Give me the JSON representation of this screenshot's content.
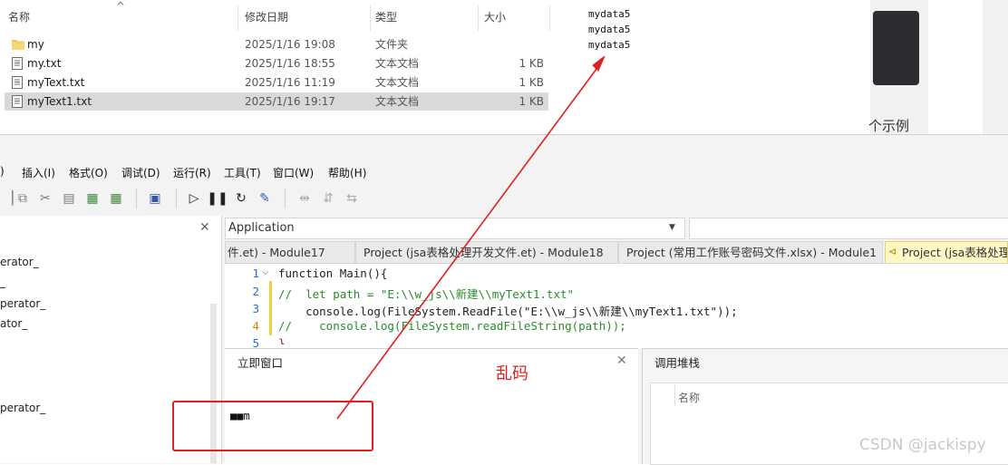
{
  "explorer": {
    "columns": [
      {
        "label": "名称"
      },
      {
        "label": "修改日期"
      },
      {
        "label": "类型"
      },
      {
        "label": "大小"
      }
    ],
    "sort_indicator": "^",
    "files": [
      {
        "name": "my",
        "date": "2025/1/16 19:08",
        "type": "文件夹",
        "size": "",
        "icon": "folder-icon",
        "selected": false
      },
      {
        "name": "my.txt",
        "date": "2025/1/16 18:55",
        "type": "文本文档",
        "size": "1 KB",
        "icon": "text-file-icon",
        "selected": false
      },
      {
        "name": "myText.txt",
        "date": "2025/1/16 11:19",
        "type": "文本文档",
        "size": "1 KB",
        "icon": "text-file-icon",
        "selected": false
      },
      {
        "name": "myText1.txt",
        "date": "2025/1/16 19:17",
        "type": "文本文档",
        "size": "1 KB",
        "icon": "text-file-icon",
        "selected": true
      }
    ]
  },
  "notepad": {
    "lines": [
      "mydata5",
      "mydata5",
      "mydata5"
    ]
  },
  "side_text": "个示例",
  "ide": {
    "menu": [
      {
        "label": ")"
      },
      {
        "label": "插入(I)"
      },
      {
        "label": "格式(O)"
      },
      {
        "label": "调试(D)"
      },
      {
        "label": "运行(R)"
      },
      {
        "label": "工具(T)"
      },
      {
        "label": "窗口(W)"
      },
      {
        "label": "帮助(H)"
      }
    ],
    "left_panel_items": [
      "erator_",
      "_",
      "perator_",
      "ator_",
      "perator_"
    ],
    "left_panel_close": "✕",
    "object_combo": "Application",
    "tabs": [
      {
        "label": "件.et) - Module17",
        "active": false
      },
      {
        "label": "Project (jsa表格处理开发文件.et) - Module18",
        "active": false
      },
      {
        "label": "Project (常用工作账号密码文件.xlsx) - Module1",
        "active": false
      },
      {
        "label": "Project (jsa表格处理开",
        "active": true
      }
    ],
    "code_lines": [
      {
        "num": "1",
        "text": "function Main(){"
      },
      {
        "num": "2",
        "text": "//  let path = \"E:\\\\w_js\\\\新建\\\\myText1.txt\""
      },
      {
        "num": "3",
        "text": "    console.log(FileSystem.ReadFile(\"E:\\\\w_js\\\\新建\\\\myText1.txt\"));"
      },
      {
        "num": "4",
        "text": "//    console.log(FileSystem.readFileString(path));"
      },
      {
        "num": "5",
        "text": "}"
      }
    ],
    "immediate": {
      "title": "立即窗口",
      "close": "✕",
      "output": "■■m"
    },
    "callstack": {
      "title": "调用堆栈",
      "column": "名称"
    }
  },
  "annotation": {
    "label": "乱码",
    "color": "#e02020"
  },
  "watermark": "CSDN @jackispy",
  "colors": {
    "selected_row": "#d9d9d9",
    "active_tab": "#fff8c4",
    "keyword": "#0000cc",
    "comment": "#2a8a2a",
    "string": "#a31515",
    "annotation_red": "#e02020"
  }
}
